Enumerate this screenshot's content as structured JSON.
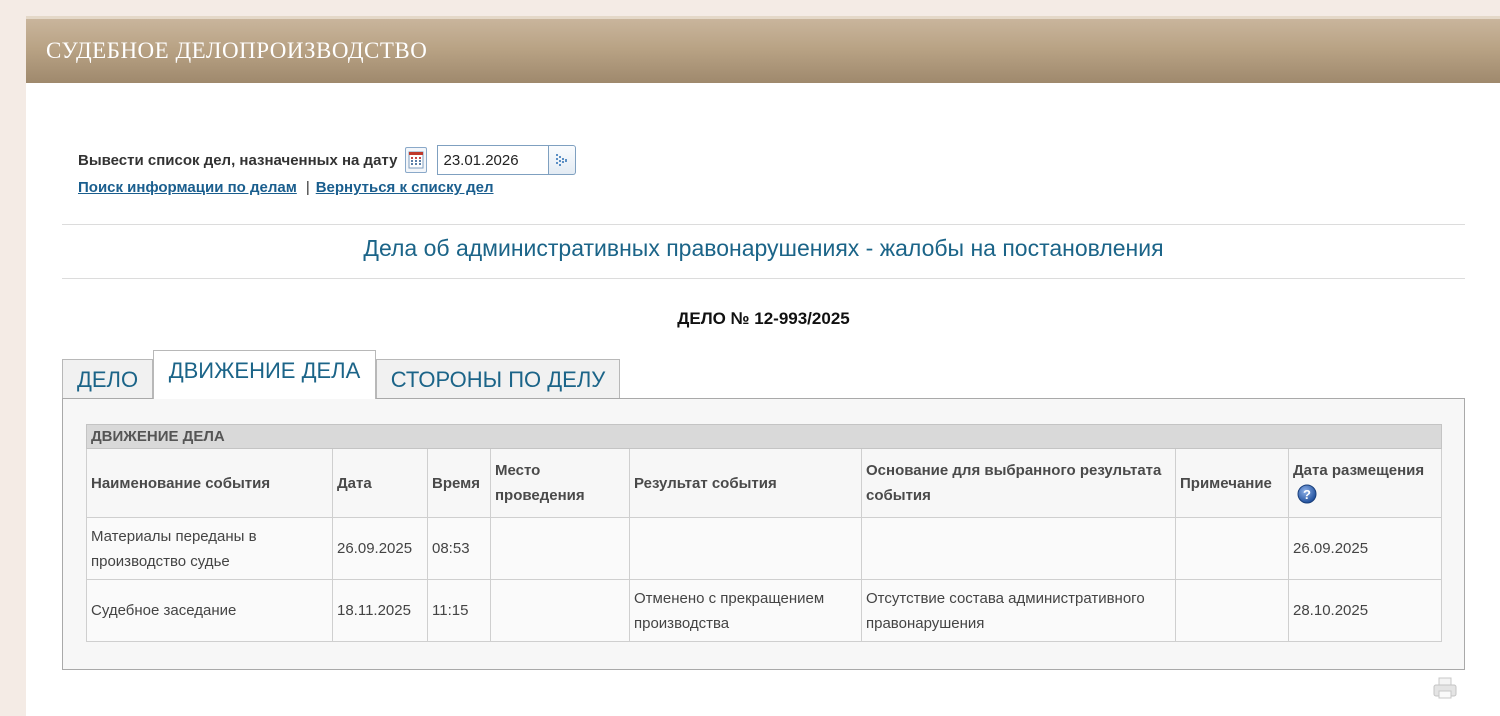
{
  "header": {
    "title": "СУДЕБНОЕ ДЕЛОПРОИЗВОДСТВО"
  },
  "date_filter": {
    "label": "Вывести список дел, назначенных на дату",
    "value": "23.01.2026",
    "calendar_icon": "calendar-icon",
    "go_icon": "arrow-go-icon"
  },
  "links": {
    "search": "Поиск информации по делам",
    "separator": "|",
    "back": "Вернуться к списку дел"
  },
  "category_title": "Дела об административных правонарушениях - жалобы на постановления",
  "case_number": "ДЕЛО № 12-993/2025",
  "tabs": [
    {
      "label": "ДЕЛО",
      "active": false
    },
    {
      "label": "ДВИЖЕНИЕ ДЕЛА",
      "active": true
    },
    {
      "label": "СТОРОНЫ ПО ДЕЛУ",
      "active": false
    }
  ],
  "events_table": {
    "caption": "ДВИЖЕНИЕ ДЕЛА",
    "columns": [
      "Наименование события",
      "Дата",
      "Время",
      "Место проведения",
      "Результат события",
      "Основание для выбранного результата события",
      "Примечание",
      "Дата размещения"
    ],
    "rows": [
      [
        "Материалы переданы в производство судье",
        "26.09.2025",
        "08:53",
        "",
        "",
        "",
        "",
        "26.09.2025"
      ],
      [
        "Судебное заседание",
        "18.11.2025",
        "11:15",
        "",
        "Отменено с прекращением производства",
        "Отсутствие состава административного правонарушения",
        "",
        "28.10.2025"
      ]
    ]
  },
  "colors": {
    "header_gradient_top": "#c9b59c",
    "header_gradient_bottom": "#9f896d",
    "accent_text": "#1b6488",
    "link": "#1a5e8e"
  }
}
